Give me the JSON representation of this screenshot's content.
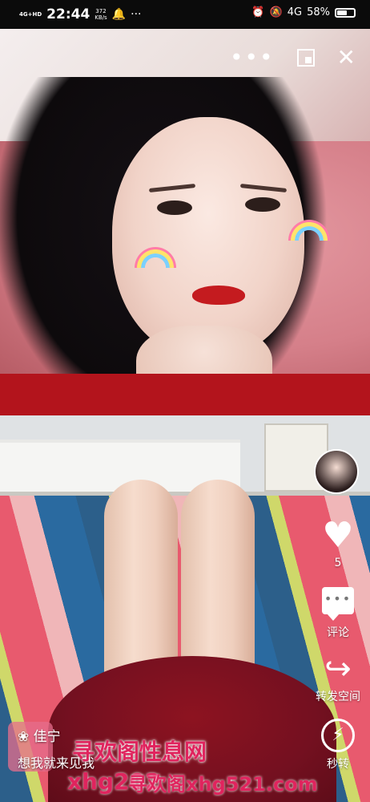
{
  "status_bar": {
    "network": "4G+HD",
    "time": "22:44",
    "speed_value": "372",
    "speed_unit": "KB/s",
    "more": "···",
    "network2": "4G",
    "battery_text": "58%",
    "battery_level": 0.58
  },
  "top_video": {
    "more_icon": "more-dots-icon",
    "more_label": "•••",
    "pip_icon": "picture-in-picture-icon",
    "close_icon": "close-icon",
    "close_label": "✕"
  },
  "rail": {
    "like_count": "5",
    "like_glyph": "♥",
    "comment_label": "评论",
    "share_label": "转发空间",
    "share_glyph": "↪",
    "quick_share_label": "秒转",
    "quick_glyph": "⚡"
  },
  "post": {
    "author": "佳宁",
    "author_prefix": "❀",
    "caption": "想我就来见我"
  },
  "watermark": {
    "title": "寻欢阁性息网",
    "url_partial": "xhg202",
    "url_full": "寻欢阁xhg521.com"
  }
}
